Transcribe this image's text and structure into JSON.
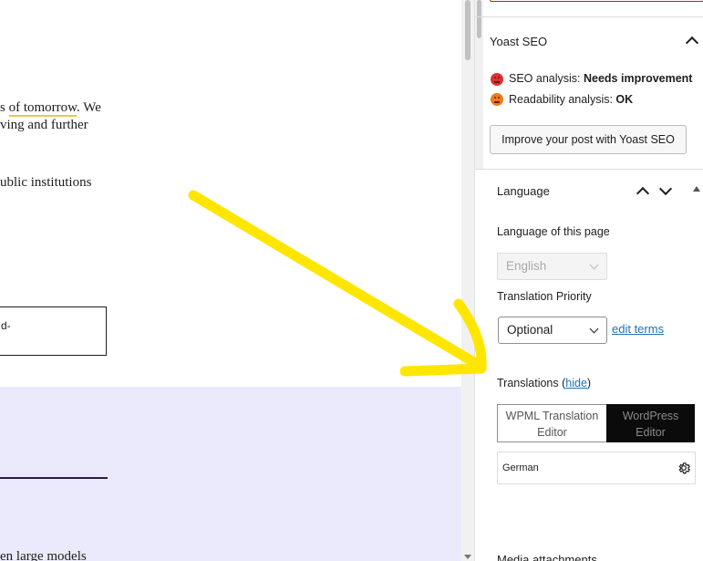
{
  "editor": {
    "line1_pre": "s ",
    "line1_underlined": "of tomorrow",
    "line1_post": ". We",
    "line2": "ving and further",
    "line3": "ublic institutions",
    "box_text": "d-",
    "lavender_text": "en large models"
  },
  "yoast": {
    "title": "Yoast SEO",
    "seo_label": "SEO analysis: ",
    "seo_value": "Needs improvement",
    "read_label": "Readability analysis: ",
    "read_value": "OK",
    "button_label": "Improve your post with Yoast SEO",
    "seo_color": "#dc3232",
    "read_color": "#ee7c1b"
  },
  "language": {
    "title": "Language",
    "page_lang_label": "Language of this page",
    "page_lang_value": "English",
    "priority_label": "Translation Priority",
    "priority_value": "Optional",
    "edit_terms": "edit terms",
    "translations_label": "Translations (",
    "hide_link": "hide",
    "translations_close": ")",
    "editor_wpml_line1": "WPML Translation",
    "editor_wpml_line2": "Editor",
    "editor_wp_line1": "WordPress",
    "editor_wp_line2": "Editor",
    "translation_lang": "German",
    "next_panel": "Media attachments"
  },
  "annotation": {
    "arrow_color": "#ffe600"
  }
}
